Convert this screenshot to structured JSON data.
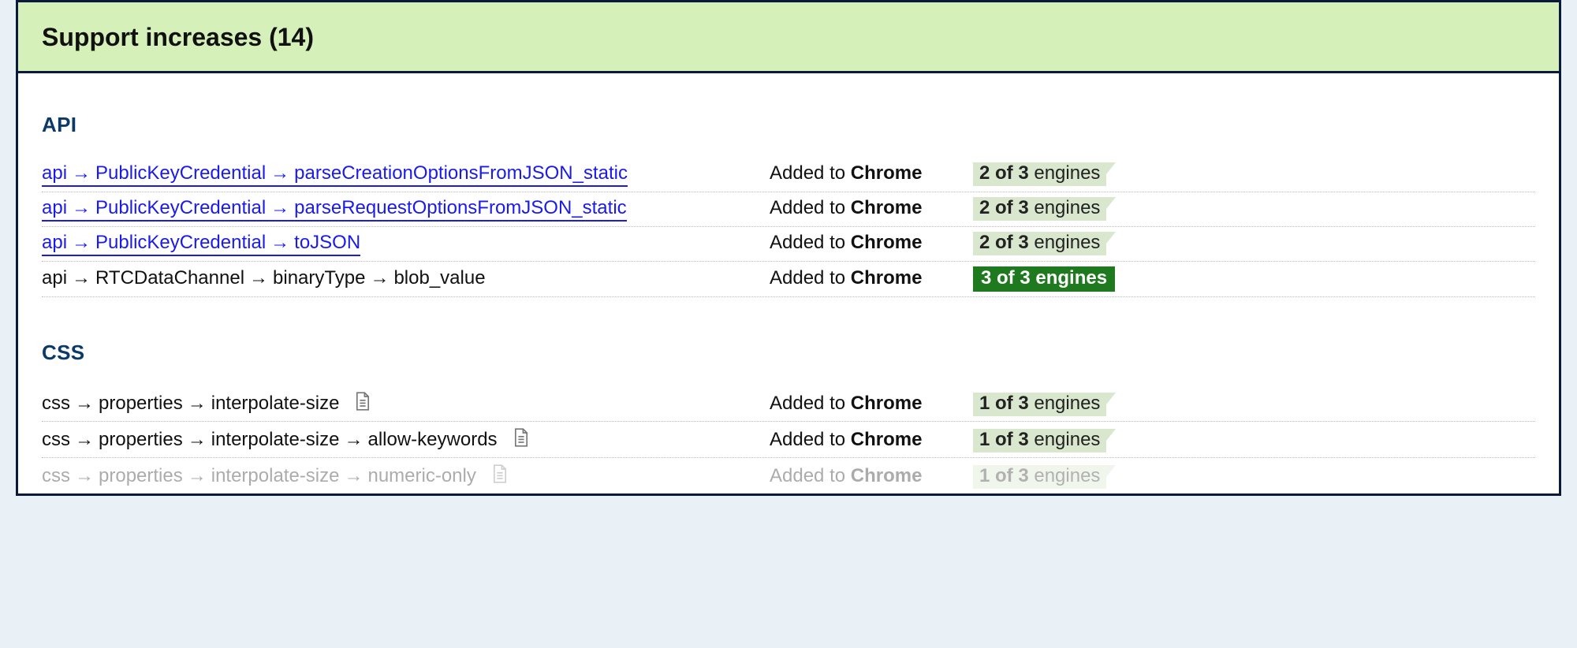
{
  "section": {
    "title": "Support increases (14)"
  },
  "groups": {
    "api": {
      "title": "API",
      "rows": [
        {
          "linked": true,
          "path": [
            "api",
            "PublicKeyCredential",
            "parseCreationOptionsFromJSON_static"
          ],
          "status_prefix": "Added to ",
          "status_browser": "Chrome",
          "engines_count": "2 of 3",
          "engines_suffix": " engines",
          "engines_style": "partial",
          "spec_icon": false
        },
        {
          "linked": true,
          "path": [
            "api",
            "PublicKeyCredential",
            "parseRequestOptionsFromJSON_static"
          ],
          "status_prefix": "Added to ",
          "status_browser": "Chrome",
          "engines_count": "2 of 3",
          "engines_suffix": " engines",
          "engines_style": "partial",
          "spec_icon": false
        },
        {
          "linked": true,
          "path": [
            "api",
            "PublicKeyCredential",
            "toJSON"
          ],
          "status_prefix": "Added to ",
          "status_browser": "Chrome",
          "engines_count": "2 of 3",
          "engines_suffix": " engines",
          "engines_style": "partial",
          "spec_icon": false
        },
        {
          "linked": false,
          "path": [
            "api",
            "RTCDataChannel",
            "binaryType",
            "blob_value"
          ],
          "status_prefix": "Added to ",
          "status_browser": "Chrome",
          "engines_count": "3 of 3",
          "engines_suffix": " engines",
          "engines_style": "full",
          "spec_icon": false
        }
      ]
    },
    "css": {
      "title": "CSS",
      "rows": [
        {
          "linked": false,
          "path": [
            "css",
            "properties",
            "interpolate-size"
          ],
          "status_prefix": "Added to ",
          "status_browser": "Chrome",
          "engines_count": "1 of 3",
          "engines_suffix": " engines",
          "engines_style": "partial",
          "spec_icon": true
        },
        {
          "linked": false,
          "path": [
            "css",
            "properties",
            "interpolate-size",
            "allow-keywords"
          ],
          "status_prefix": "Added to ",
          "status_browser": "Chrome",
          "engines_count": "1 of 3",
          "engines_suffix": " engines",
          "engines_style": "partial",
          "spec_icon": true
        },
        {
          "linked": false,
          "path": [
            "css",
            "properties",
            "interpolate-size",
            "numeric-only"
          ],
          "status_prefix": "Added to ",
          "status_browser": "Chrome",
          "engines_count": "1 of 3",
          "engines_suffix": " engines",
          "engines_style": "partial",
          "spec_icon": true
        }
      ]
    }
  },
  "glyphs": {
    "arrow": "→"
  }
}
